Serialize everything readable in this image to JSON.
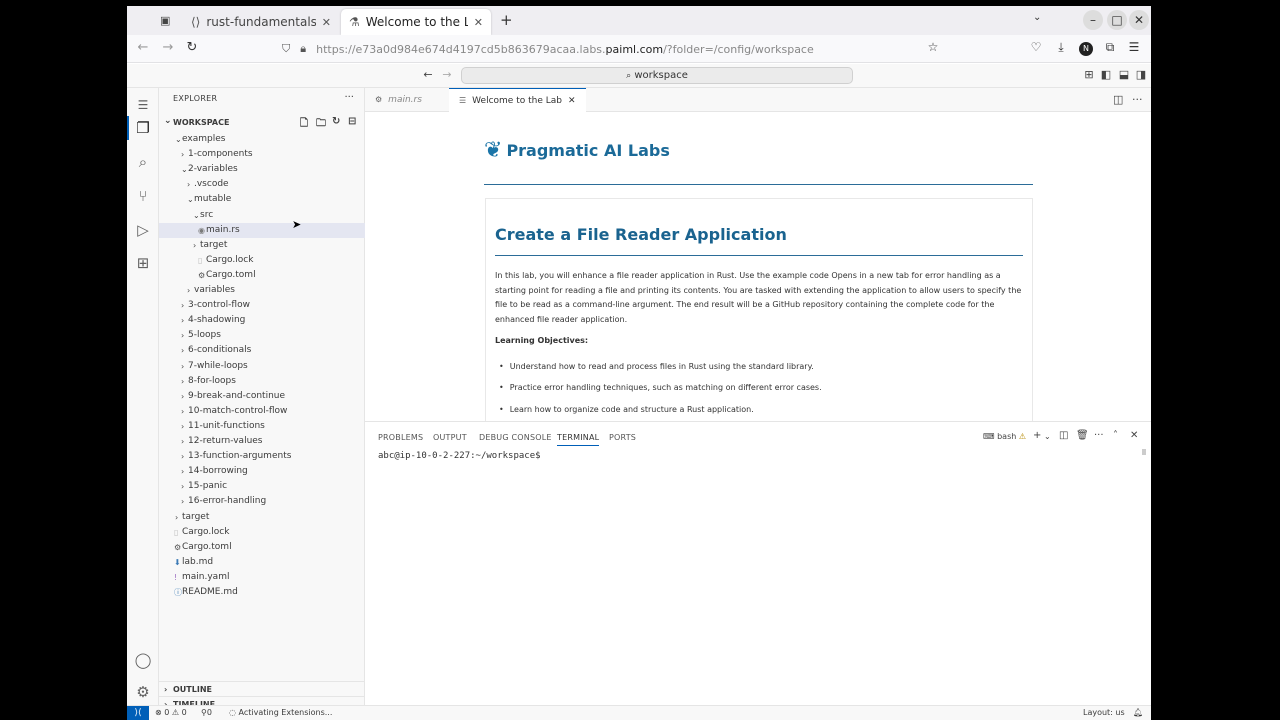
{
  "browser": {
    "tabs": [
      {
        "label": "rust-fundamentals - Code Br",
        "close": "✕",
        "icon": "code-icon"
      },
      {
        "label": "Welcome to the Lab - wo",
        "close": "✕",
        "icon": "lab-icon"
      }
    ],
    "new_tab": "+",
    "url": {
      "prefix": "https://e73a0d984e674d4197cd5b863679acaa.labs.",
      "host": "paiml.com",
      "suffix": "/?folder=/config/workspace"
    },
    "window_controls": {
      "minimize": "–",
      "maximize": "□",
      "close": "✕"
    }
  },
  "vscode": {
    "command_center": "workspace",
    "explorer": {
      "header": "EXPLORER",
      "workspace_label": "WORKSPACE",
      "tree": [
        {
          "name": "examples",
          "depth": 1,
          "kind": "folder-open"
        },
        {
          "name": "1-components",
          "depth": 2,
          "kind": "folder"
        },
        {
          "name": "2-variables",
          "depth": 2,
          "kind": "folder-open"
        },
        {
          "name": ".vscode",
          "depth": 3,
          "kind": "folder"
        },
        {
          "name": "mutable",
          "depth": 3,
          "kind": "folder-open"
        },
        {
          "name": "src",
          "depth": 4,
          "kind": "folder-open"
        },
        {
          "name": "main.rs",
          "depth": 5,
          "kind": "rust",
          "selected": true
        },
        {
          "name": "target",
          "depth": 4,
          "kind": "folder"
        },
        {
          "name": "Cargo.lock",
          "depth": 5,
          "kind": "lock"
        },
        {
          "name": "Cargo.toml",
          "depth": 5,
          "kind": "gear"
        },
        {
          "name": "variables",
          "depth": 3,
          "kind": "folder"
        },
        {
          "name": "3-control-flow",
          "depth": 2,
          "kind": "folder"
        },
        {
          "name": "4-shadowing",
          "depth": 2,
          "kind": "folder"
        },
        {
          "name": "5-loops",
          "depth": 2,
          "kind": "folder"
        },
        {
          "name": "6-conditionals",
          "depth": 2,
          "kind": "folder"
        },
        {
          "name": "7-while-loops",
          "depth": 2,
          "kind": "folder"
        },
        {
          "name": "8-for-loops",
          "depth": 2,
          "kind": "folder"
        },
        {
          "name": "9-break-and-continue",
          "depth": 2,
          "kind": "folder"
        },
        {
          "name": "10-match-control-flow",
          "depth": 2,
          "kind": "folder"
        },
        {
          "name": "11-unit-functions",
          "depth": 2,
          "kind": "folder"
        },
        {
          "name": "12-return-values",
          "depth": 2,
          "kind": "folder"
        },
        {
          "name": "13-function-arguments",
          "depth": 2,
          "kind": "folder"
        },
        {
          "name": "14-borrowing",
          "depth": 2,
          "kind": "folder"
        },
        {
          "name": "15-panic",
          "depth": 2,
          "kind": "folder"
        },
        {
          "name": "16-error-handling",
          "depth": 2,
          "kind": "folder"
        },
        {
          "name": "target",
          "depth": 1,
          "kind": "folder"
        },
        {
          "name": "Cargo.lock",
          "depth": 1,
          "kind": "lock"
        },
        {
          "name": "Cargo.toml",
          "depth": 1,
          "kind": "gear"
        },
        {
          "name": "lab.md",
          "depth": 1,
          "kind": "markdown"
        },
        {
          "name": "main.yaml",
          "depth": 1,
          "kind": "yaml"
        },
        {
          "name": "README.md",
          "depth": 1,
          "kind": "info"
        }
      ],
      "outline": "OUTLINE",
      "timeline": "TIMELINE"
    },
    "editor_tabs": [
      {
        "label": "main.rs",
        "active": false
      },
      {
        "label": "Welcome to the Lab",
        "active": true,
        "close": "✕"
      }
    ],
    "welcome": {
      "brand": "Pragmatic AI Labs",
      "title": "Create a File Reader Application",
      "intro": "In this lab, you will enhance a file reader application in Rust.  Use the example code Opens in a new tab   for error handling as a starting point for reading a file and printing its contents. You are tasked with extending the application to allow users to specify the file to be read as a command-line argument. The end result will be a GitHub repository containing the complete code for the enhanced file reader application.",
      "objectives_heading": "Learning Objectives:",
      "objectives": [
        "Understand how to read and process files in Rust using the standard library.",
        "Practice error handling techniques, such as matching on different error cases.",
        "Learn how to organize code and structure a Rust application."
      ]
    },
    "panel": {
      "tabs": [
        "PROBLEMS",
        "OUTPUT",
        "DEBUG CONSOLE",
        "TERMINAL",
        "PORTS"
      ],
      "active_tab": "TERMINAL",
      "shell": "bash",
      "prompt": "abc@ip-10-0-2-227:~/workspace$"
    },
    "status": {
      "errors": "0",
      "warnings": "0",
      "ports": "0",
      "message": "Activating Extensions...",
      "layout": "Layout: us"
    }
  },
  "colors": {
    "accent": "#005fb8",
    "brand": "#1b6a98"
  }
}
